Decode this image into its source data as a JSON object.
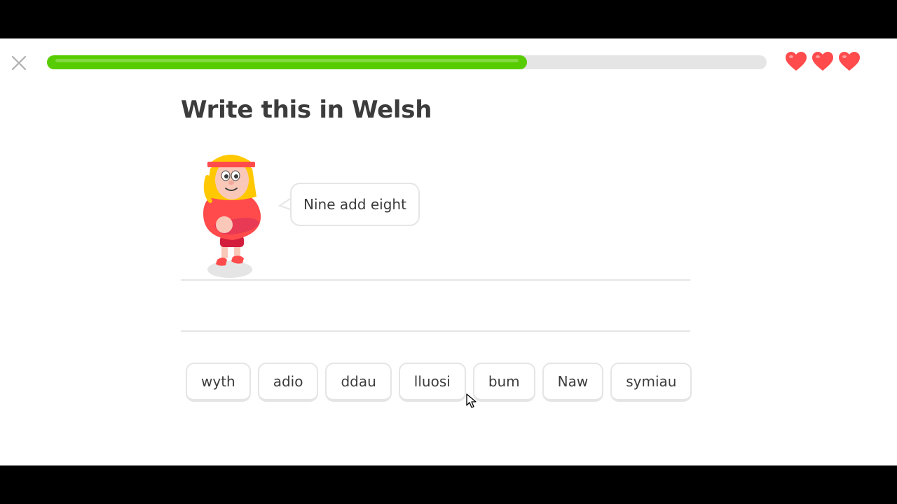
{
  "header": {
    "close_icon": "close-icon",
    "progress": 0.667,
    "progress_color": "#58cc02",
    "hearts": {
      "count": 3,
      "icon": "heart-icon",
      "color": "#ff4b4b"
    }
  },
  "main": {
    "title": "Write this in Welsh",
    "character_icon": "character-illustration",
    "prompt": "Nine add eight"
  },
  "word_bank": {
    "words": [
      "wyth",
      "adio",
      "ddau",
      "lluosi",
      "bum",
      "Naw",
      "symiau"
    ]
  }
}
